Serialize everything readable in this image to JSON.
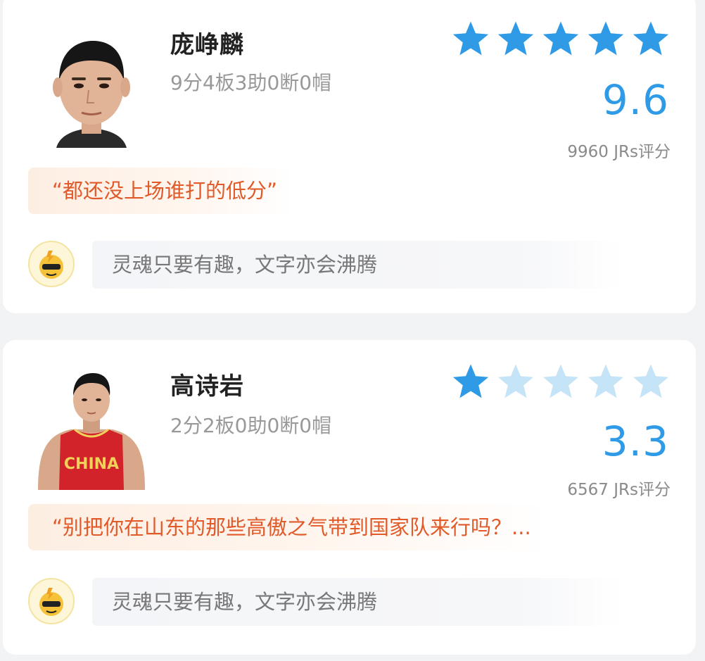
{
  "players": [
    {
      "name": "庞峥麟",
      "stats": "9分4板3助0断0帽",
      "stars_filled": 5,
      "stars_total": 5,
      "score": "9.6",
      "rating_count": "9960 JRs评分",
      "quote": "“都还没上场谁打的低分”",
      "comment_placeholder": "灵魂只要有趣，文字亦会沸腾"
    },
    {
      "name": "高诗岩",
      "stats": "2分2板0助0断0帽",
      "stars_filled": 1,
      "stars_total": 5,
      "score": "3.3",
      "rating_count": "6567 JRs评分",
      "quote": "“别把你在山东的那些高傲之气带到国家队来行吗？...",
      "comment_placeholder": "灵魂只要有趣，文字亦会沸腾",
      "jersey_text": "CHINA"
    }
  ],
  "colors": {
    "star_filled": "#2f9be6",
    "star_empty": "#c6e4f8",
    "score": "#2f9be6",
    "quote_text": "#e05a2a"
  },
  "icons": {
    "star": "star-icon",
    "avatar": "user-avatar-icon"
  }
}
